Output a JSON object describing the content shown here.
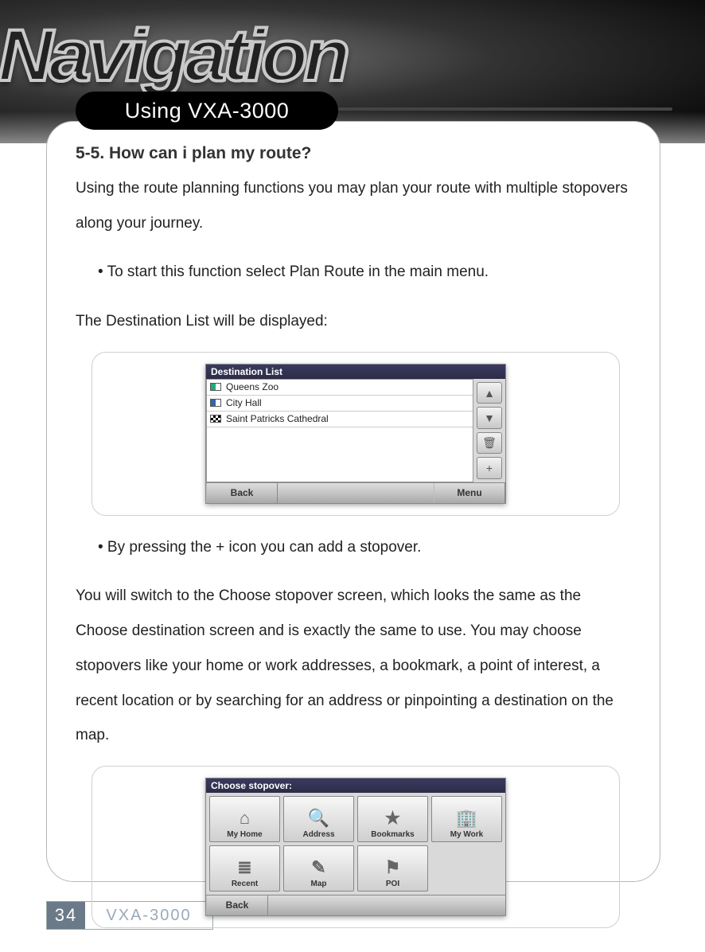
{
  "header": {
    "brand_title": "Navigation",
    "chapter": "Using VXA-3000"
  },
  "content": {
    "section_title": "5-5. How can i plan my route?",
    "intro": "Using the route planning functions you may plan your route with multiple stopovers along your journey.",
    "bullet1": "• To start this function select Plan Route in the main menu.",
    "dest_intro": "The Destination List will be displayed:",
    "bullet2": "• By pressing the + icon you can add a stopover.",
    "stopover_para": "You will switch to the Choose stopover screen, which looks the same as the Choose destination screen and is exactly the same to use. You may choose stopovers like your home or work addresses, a bookmark, a point of interest, a recent location or by searching for an address or pinpointing a destination on the map."
  },
  "screens": {
    "dest_list": {
      "title": "Destination List",
      "items": [
        "Queens Zoo",
        "City Hall",
        "Saint Patricks Cathedral"
      ],
      "side_icons": [
        "▲",
        "▼",
        "🗑",
        "+"
      ],
      "footer": {
        "back": "Back",
        "menu": "Menu"
      }
    },
    "choose_stopover": {
      "title": "Choose stopover:",
      "tiles_row1": [
        {
          "label": "My Home",
          "glyph": "⌂"
        },
        {
          "label": "Address",
          "glyph": "🔍"
        },
        {
          "label": "Bookmarks",
          "glyph": "★"
        },
        {
          "label": "My Work",
          "glyph": "🏢"
        }
      ],
      "tiles_row2": [
        {
          "label": "Recent",
          "glyph": "≣"
        },
        {
          "label": "Map",
          "glyph": "✎"
        },
        {
          "label": "POI",
          "glyph": "⚑"
        }
      ],
      "footer": {
        "back": "Back"
      }
    }
  },
  "footer": {
    "page": "34",
    "model": "VXA-3000"
  }
}
